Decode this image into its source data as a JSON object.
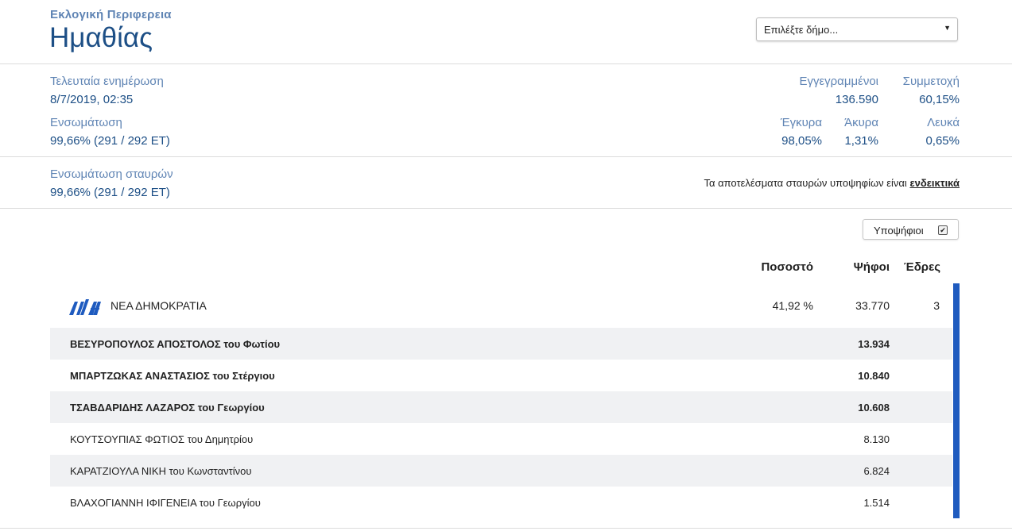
{
  "header": {
    "subtitle": "Εκλογική Περιφερεια",
    "title": "Ημαθίας",
    "municipality_select": {
      "selected": "Επιλέξτε δήμο..."
    }
  },
  "stats": {
    "last_update_label": "Τελευταία ενημέρωση",
    "last_update_value": "8/7/2019, 02:35",
    "incorporation_label": "Ενσωμάτωση",
    "incorporation_value": "99,66% (291 / 292 ΕΤ)",
    "registered_label": "Εγγεγραμμένοι",
    "registered_value": "136.590",
    "turnout_label": "Συμμετοχή",
    "turnout_value": "60,15%",
    "valid_label": "Έγκυρα",
    "valid_value": "98,05%",
    "invalid_label": "Άκυρα",
    "invalid_value": "1,31%",
    "blank_label": "Λευκά",
    "blank_value": "0,65%"
  },
  "preferences": {
    "label": "Ενσωμάτωση σταυρών",
    "value": "99,66% (291 / 292 ΕΤ)",
    "note": "Τα αποτελέσματα σταυρών υποψηφίων είναι",
    "note_link": "ενδεικτικά"
  },
  "candidates_toggle": {
    "label": "Υποψήφιοι",
    "checked": true,
    "check_mark": "✔"
  },
  "results": {
    "columns": {
      "percent": "Ποσοστό",
      "votes": "Ψήφοι",
      "seats": "Έδρες"
    },
    "party": {
      "name": "ΝΕΑ ΔΗΜΟΚΡΑΤΙΑ",
      "percent": "41,92 %",
      "votes": "33.770",
      "seats": "3",
      "color": "#1f5bbf",
      "logo_icon": "nd-logo-icon"
    },
    "candidates": [
      {
        "name": "ΒΕΣΥΡΟΠΟΥΛΟΣ ΑΠΟΣΤΟΛΟΣ του Φωτίου",
        "votes": "13.934"
      },
      {
        "name": "ΜΠΑΡΤΖΩΚΑΣ ΑΝΑΣΤΑΣΙΟΣ του Στέργιου",
        "votes": "10.840"
      },
      {
        "name": "ΤΣΑΒΔΑΡΙΔΗΣ ΛΑΖΑΡΟΣ του Γεωργίου",
        "votes": "10.608"
      },
      {
        "name": "ΚΟΥΤΣΟΥΠΙΑΣ ΦΩΤΙΟΣ του Δημητρίου",
        "votes": "8.130"
      },
      {
        "name": "ΚΑΡΑΤΖΙΟΥΛΑ ΝΙΚΗ του Κωνσταντίνου",
        "votes": "6.824"
      },
      {
        "name": "ΒΛΑΧΟΓΙΑΝΝΗ ΙΦΙΓΕΝΕΙΑ του Γεωργίου",
        "votes": "1.514"
      }
    ]
  }
}
